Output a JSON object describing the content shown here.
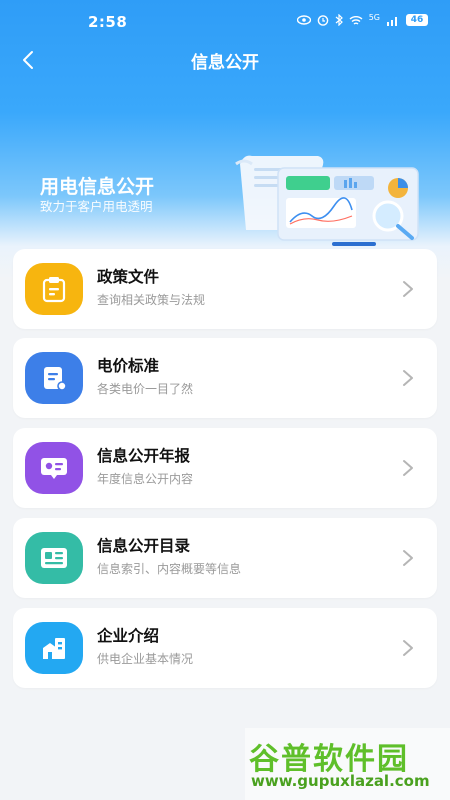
{
  "status_bar": {
    "time": "2:58",
    "network": "5G",
    "battery": "46"
  },
  "nav": {
    "title": "信息公开",
    "back_icon": "chevron-left-icon"
  },
  "banner": {
    "title": "用电信息公开",
    "subtitle": "致力于客户用电透明"
  },
  "cards": [
    {
      "title": "政策文件",
      "desc": "查询相关政策与法规",
      "icon": "clipboard-icon",
      "color": "#f7b50f"
    },
    {
      "title": "电价标准",
      "desc": "各类电价一目了然",
      "icon": "document-icon",
      "color": "#3d7fe8"
    },
    {
      "title": "信息公开年报",
      "desc": "年度信息公开内容",
      "icon": "presentation-icon",
      "color": "#9152e6"
    },
    {
      "title": "信息公开目录",
      "desc": "信息索引、内容概要等信息",
      "icon": "catalog-icon",
      "color": "#34bca6"
    },
    {
      "title": "企业介绍",
      "desc": "供电企业基本情况",
      "icon": "building-icon",
      "color": "#23a8f2"
    }
  ],
  "watermark": {
    "name": "谷普软件园",
    "url": "www.gupuxlazal.com"
  }
}
